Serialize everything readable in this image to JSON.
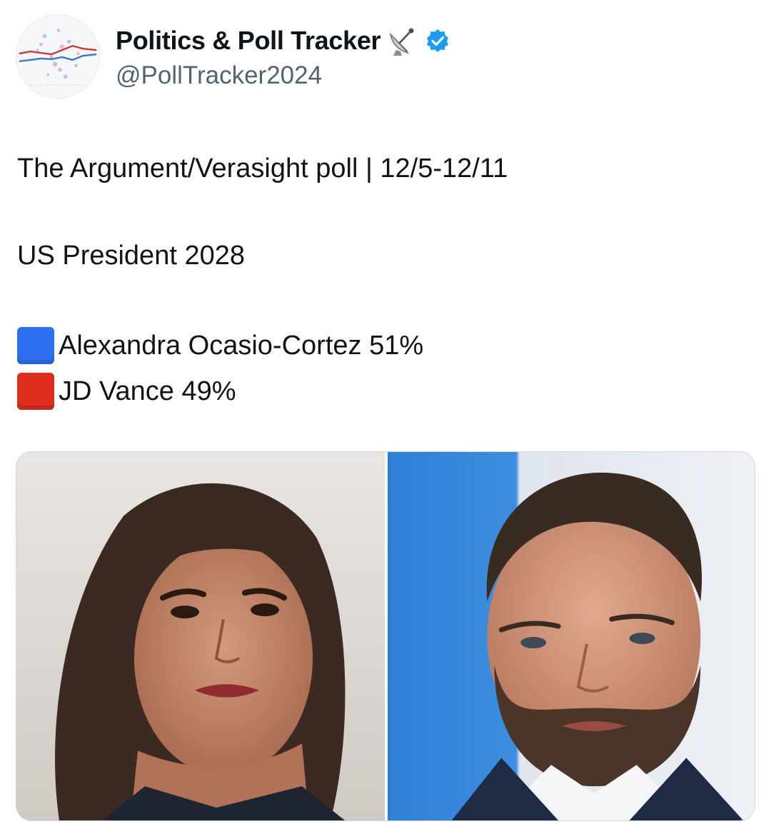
{
  "account": {
    "display_name": "Politics & Poll Tracker",
    "handle": "@PollTracker2024",
    "name_emoji": "satellite-dish-icon",
    "verified": true,
    "verified_color": "#1d9bf0"
  },
  "post": {
    "poll_line": "The Argument/Verasight poll | 12/5-12/11",
    "race": "US President 2028",
    "candidates": [
      {
        "marker": "blue-square-icon",
        "marker_color": "#2e6ff0",
        "text": "Alexandra Ocasio-Cortez 51%"
      },
      {
        "marker": "red-square-icon",
        "marker_color": "#dd2e1f",
        "text": "JD Vance 49%"
      }
    ]
  },
  "media": {
    "images": [
      "portrait-left",
      "portrait-right"
    ]
  }
}
